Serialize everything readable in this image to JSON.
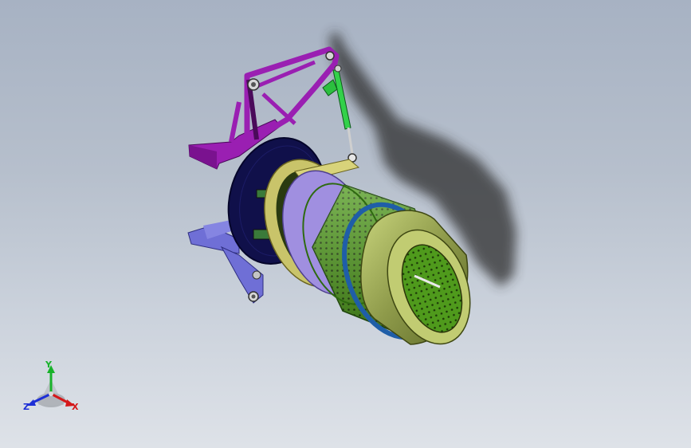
{
  "viewport": {
    "background_top": "#a7b2c3",
    "background_bottom": "#dee2e8"
  },
  "model": {
    "parts": [
      {
        "name": "upper-bracket",
        "color": "#9a1fb2"
      },
      {
        "name": "lower-bracket",
        "color": "#6f6fd6"
      },
      {
        "name": "hydraulic-cylinder",
        "color": "#33d14a"
      },
      {
        "name": "mounting-disc",
        "color": "#10104a"
      },
      {
        "name": "yellow-ring",
        "color": "#c9c46a"
      },
      {
        "name": "lavender-ring",
        "color": "#a08fe0"
      },
      {
        "name": "perforated-drum",
        "color": "#5aa221"
      },
      {
        "name": "blue-band",
        "color": "#1f5ea8"
      },
      {
        "name": "olive-shroud",
        "color": "#8e9a4a"
      },
      {
        "name": "shadow",
        "color": "#303030"
      }
    ]
  },
  "triad": {
    "y_label": "Y",
    "z_label": "Z",
    "x_label": "X",
    "y_color": "#18b22a",
    "z_color": "#1d2fd6",
    "x_color": "#d4181a"
  }
}
